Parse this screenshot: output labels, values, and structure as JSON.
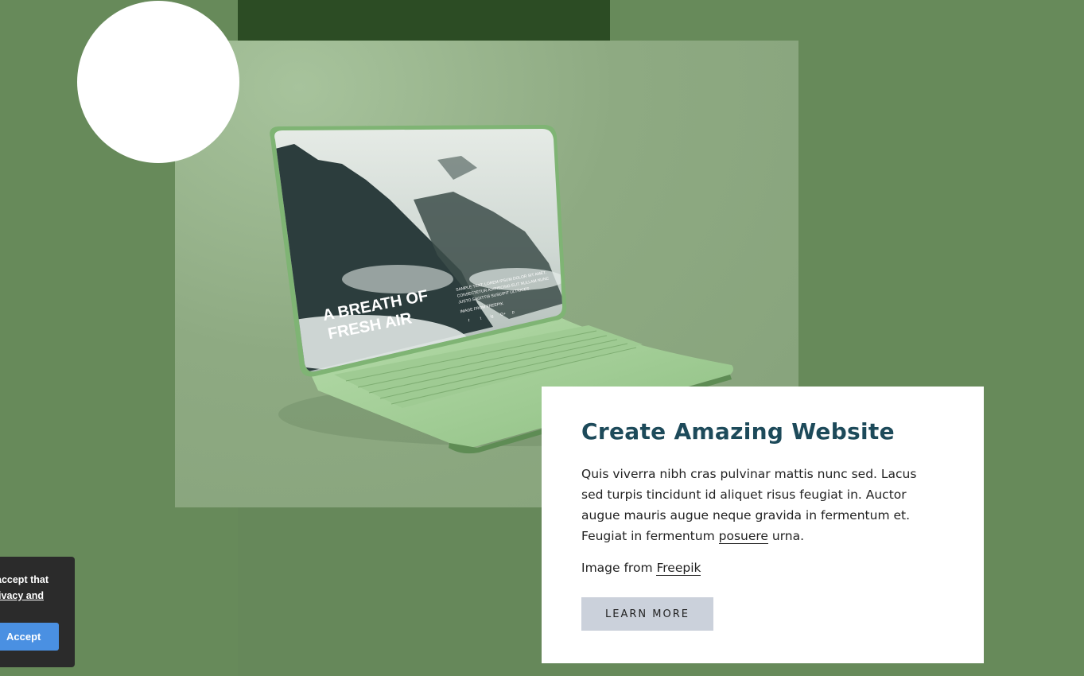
{
  "colors": {
    "background": "#678a5a",
    "dark_band": "#2c4c24",
    "heading": "#1d4a5a",
    "button_bg": "#cbd1db",
    "accept_bg": "#4a90e2"
  },
  "hero_image": {
    "screen_heading": "A BREATH OF\nFRESH AIR",
    "screen_heading_line1": "A BREATH OF",
    "screen_heading_line2": "FRESH AIR",
    "screen_small_text_1": "SAMPLE TEXT. LOREM IPSUM DOLOR SIT AMET,",
    "screen_small_text_2": "CONSECTETUR ADIPISCING ELIT NULLAM NUNC",
    "screen_small_text_3": "JUSTO SAGITTIS SUSCIPIT ULTRICES.",
    "screen_credit": "IMAGE FROM FREEPIK",
    "screen_social": [
      "f",
      "t",
      "ig",
      "G+",
      "p"
    ]
  },
  "card": {
    "title": "Create Amazing Website",
    "body_before_link": "Quis viverra nibh cras pulvinar mattis nunc sed. Lacus sed turpis tincidunt id aliquet risus feugiat in.  Auctor augue mauris augue neque gravida in fermentum et. Feugiat in fermentum ",
    "body_link": "posuere",
    "body_after_link": " urna.",
    "credit_prefix": "Image from ",
    "credit_link": "Freepik",
    "button_label": "LEARN MORE"
  },
  "cookie_banner": {
    "line1": "accept that",
    "line2": "ivacy and",
    "accept_label": "Accept"
  }
}
